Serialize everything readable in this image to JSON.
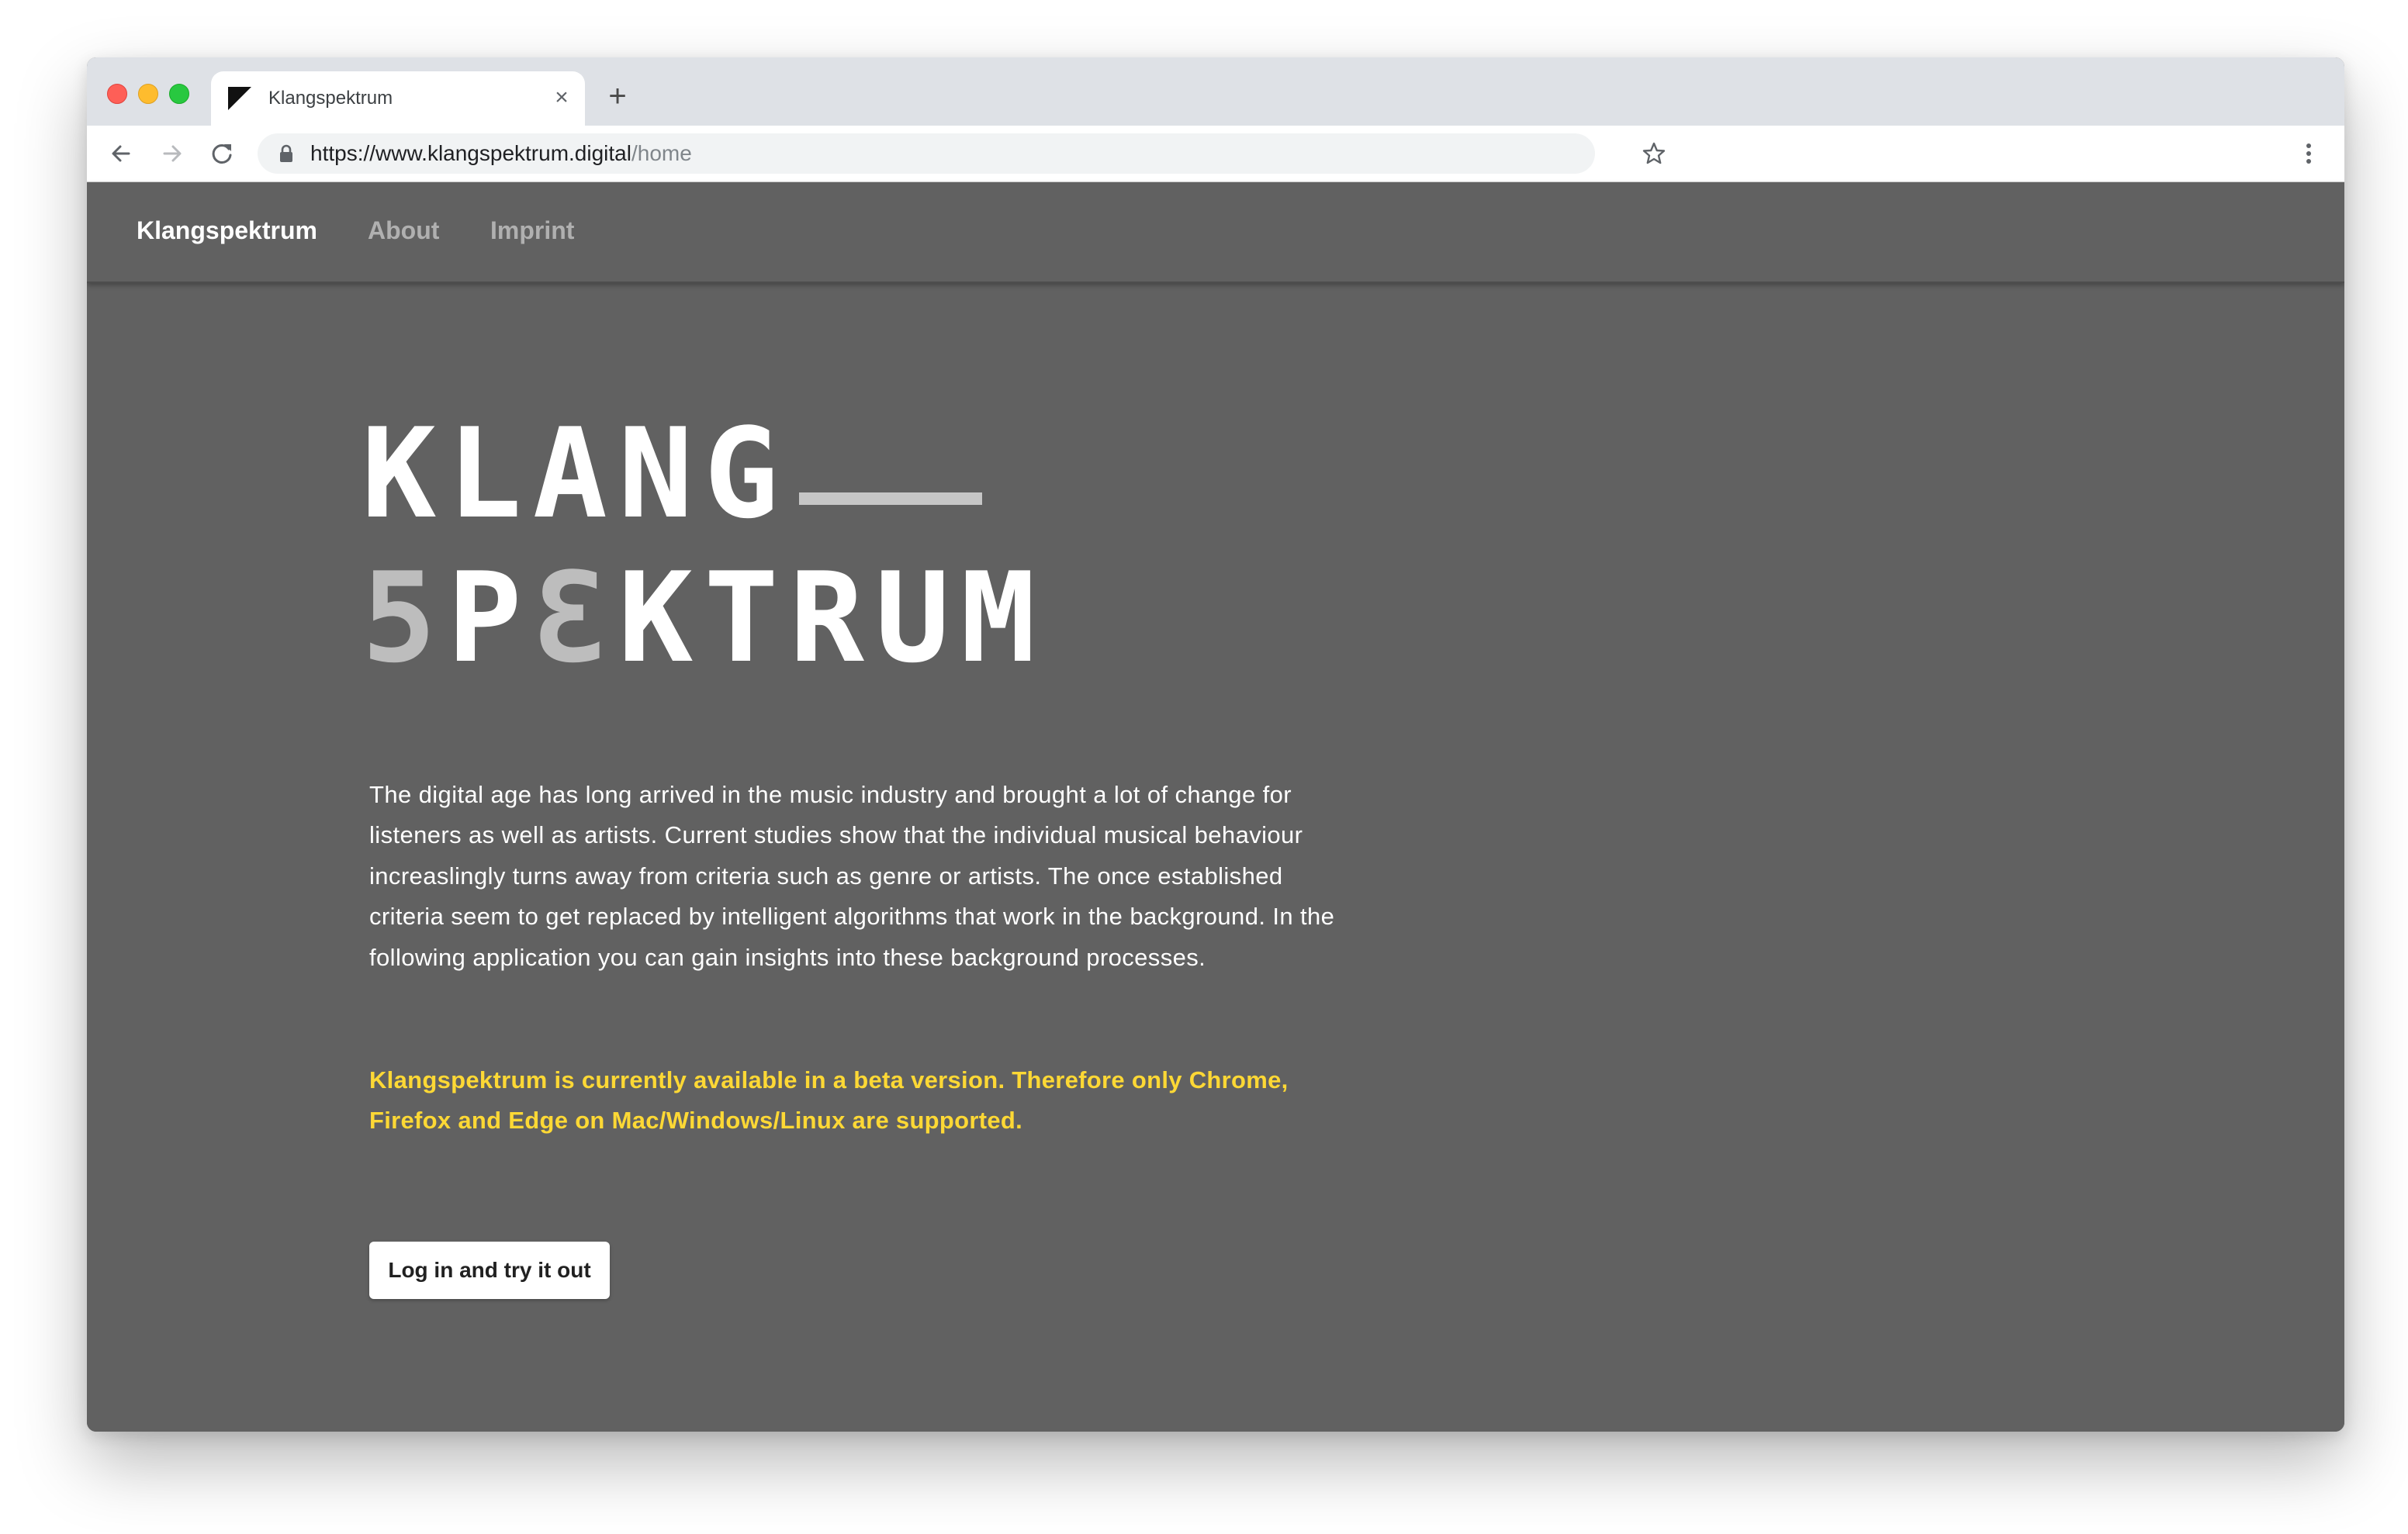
{
  "browser": {
    "tab": {
      "title": "Klangspektrum",
      "close_glyph": "×",
      "favicon": "klangspektrum-favicon"
    },
    "new_tab_glyph": "+",
    "address": {
      "host": "https://www.klangspektrum.digital",
      "path": "/home"
    },
    "icons": [
      "back-icon",
      "forward-icon",
      "reload-icon",
      "lock-icon",
      "star-icon",
      "menu-icon"
    ]
  },
  "navbar": {
    "brand": "Klangspektrum",
    "links": [
      {
        "label": "About"
      },
      {
        "label": "Imprint"
      }
    ]
  },
  "logo": {
    "line1": "KLANG",
    "line2_prefix": "5",
    "line2_a": "P",
    "line2_b": "Ɛ",
    "line2_c": "KTRUM",
    "accent_color": "#bdbdbd"
  },
  "hero": {
    "description": "The digital age has long arrived in the music industry and brought a lot of change for listeners as well as artists. Current studies show that the individual musical behaviour increaslingly turns away from criteria such as genre or artists. The once established criteria seem to get replaced by intelligent algorithms that work in the background. In the following application you can gain insights into these background processes.",
    "beta_notice": "Klangspektrum is currently available in a beta version. Therefore only Chrome, Firefox and Edge on Mac/Windows/Linux are supported.",
    "beta_color": "#fdd835",
    "cta_label": "Log in and try it out"
  },
  "colors": {
    "page_background": "#616161",
    "tabstrip": "#dee1e6"
  }
}
